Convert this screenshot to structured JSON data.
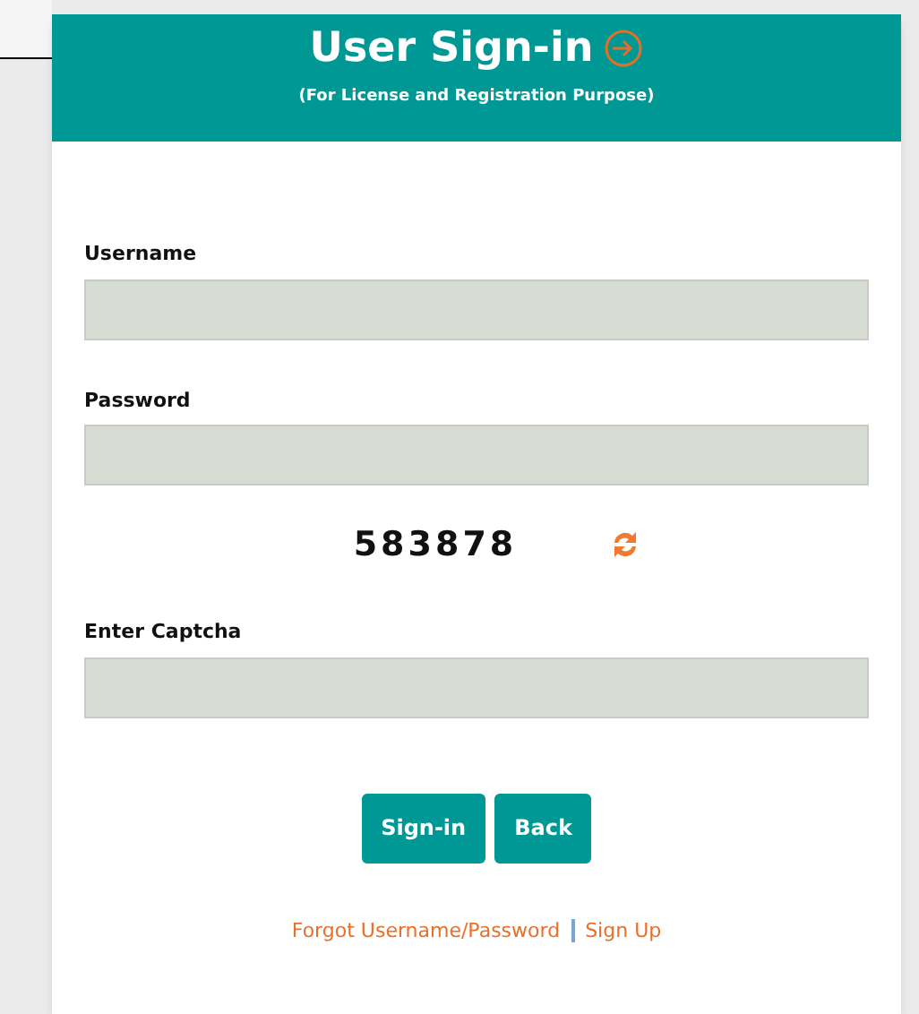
{
  "header": {
    "title": "User Sign-in",
    "subtitle": "(For License and Registration Purpose)"
  },
  "fields": [
    {
      "label": "Username"
    },
    {
      "label": "Password"
    }
  ],
  "captcha": {
    "code": "583878"
  },
  "captcha_field": {
    "label": "Enter Captcha"
  },
  "buttons": [
    "Sign-in",
    "Back"
  ],
  "links": [
    "Forgot Username/Password",
    "Sign Up"
  ]
}
